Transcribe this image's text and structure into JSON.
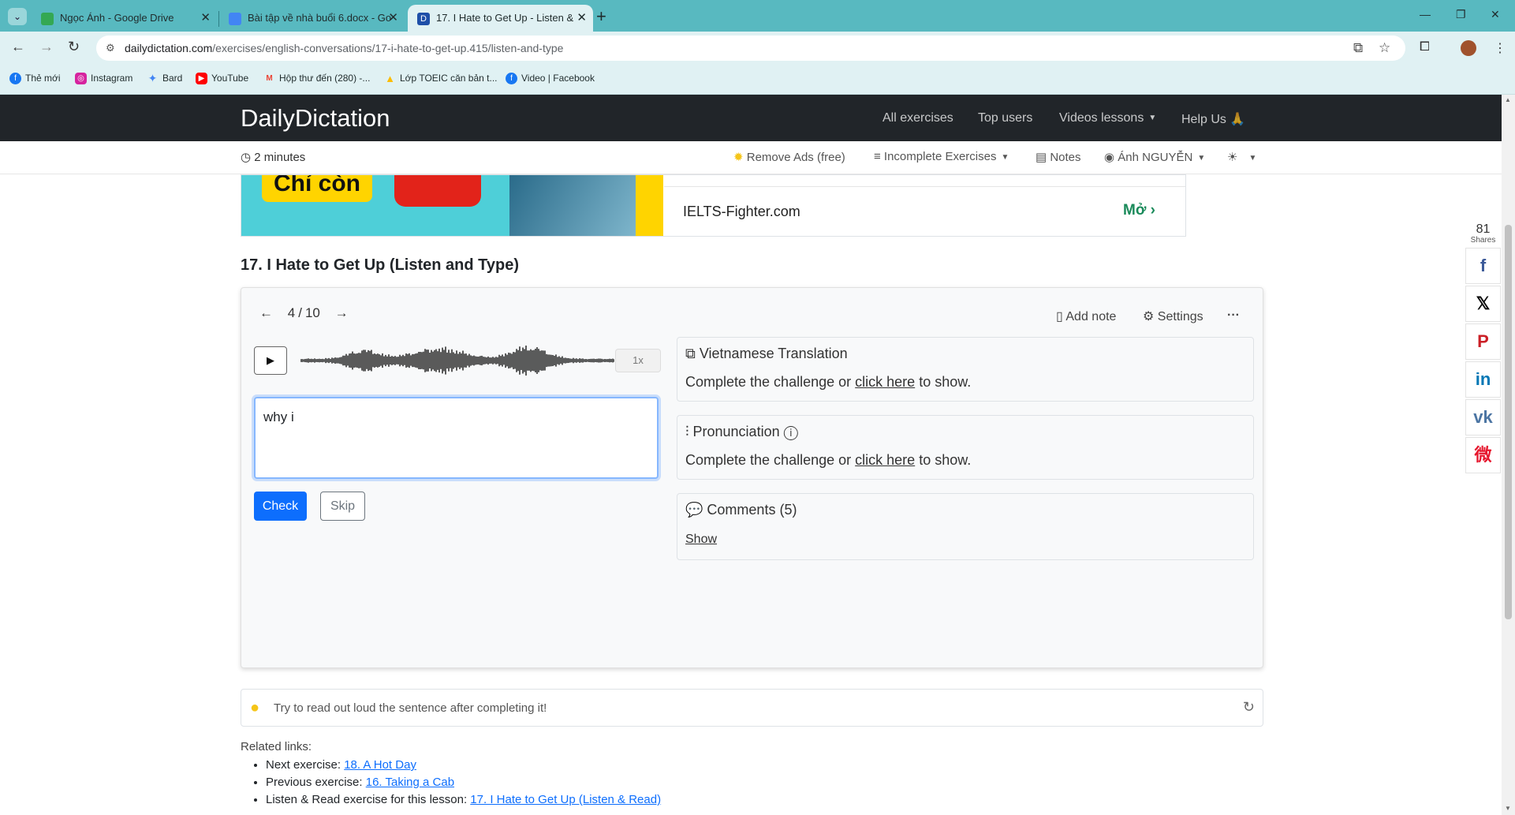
{
  "browser": {
    "tabs": [
      {
        "title": "Ngọc Ánh - Google Drive",
        "color": "#34a853"
      },
      {
        "title": "Bài tập về nhà buổi 6.docx - Go",
        "color": "#4285f4"
      },
      {
        "title": "17. I Hate to Get Up - Listen &",
        "color": "#1e4fa8"
      }
    ],
    "new_tab": "+",
    "url_domain": "dailydictation.com",
    "url_path": "/exercises/english-conversations/17-i-hate-to-get-up.415/listen-and-type",
    "bookmarks": [
      {
        "label": "Thẻ mới",
        "color": "#1877f2"
      },
      {
        "label": "Instagram",
        "color": "#d6249f"
      },
      {
        "label": "Bard",
        "color": "#4285f4"
      },
      {
        "label": "YouTube",
        "color": "#ff0000"
      },
      {
        "label": "Hộp thư đến (280) -...",
        "color": "#ea4335"
      },
      {
        "label": "Lớp TOEIC căn bản t...",
        "color": "#fbbc04"
      },
      {
        "label": "Video | Facebook",
        "color": "#1877f2"
      }
    ]
  },
  "site": {
    "brand": "DailyDictation",
    "nav": {
      "all_exercises": "All exercises",
      "top_users": "Top users",
      "video_lessons": "Videos lessons",
      "help_us": "Help Us 🙏"
    },
    "subbar": {
      "timer": "2 minutes",
      "remove_ads": "Remove Ads (free)",
      "incomplete": "Incomplete Exercises",
      "notes": "Notes",
      "user": "Ánh NGUYỄN"
    }
  },
  "ad": {
    "headline": "Chỉ còn",
    "site": "IELTS-Fighter.com",
    "open": "Mở"
  },
  "exercise": {
    "title": "17. I Hate to Get Up (Listen and Type)",
    "current": "4",
    "total": "10",
    "pager_sep": "/",
    "add_note": "Add note",
    "settings": "Settings",
    "speed": "1x",
    "answer_text": "why i",
    "check_label": "Check",
    "skip_label": "Skip",
    "translation": {
      "title": "Vietnamese Translation",
      "prefix": "Complete the challenge or",
      "link": "click here",
      "suffix": "to show."
    },
    "pronunciation": {
      "title": "Pronunciation",
      "prefix": "Complete the challenge or",
      "link": "click here",
      "suffix": "to show."
    },
    "comments": {
      "title": "Comments (5)",
      "show": "Show"
    }
  },
  "tip": "Try to read out loud the sentence after completing it!",
  "related": {
    "heading": "Related links:",
    "items": [
      {
        "label": "Next exercise:",
        "link": "18. A Hot Day"
      },
      {
        "label": "Previous exercise:",
        "link": "16. Taking a Cab"
      },
      {
        "label": "Listen & Read exercise for this lesson:",
        "link": "17. I Hate to Get Up (Listen & Read)"
      }
    ]
  },
  "share": {
    "count": "81",
    "label": "Shares",
    "buttons": [
      {
        "name": "facebook",
        "glyph": "f",
        "color": "#3b5998"
      },
      {
        "name": "x",
        "glyph": "𝕏",
        "color": "#000000"
      },
      {
        "name": "pinterest",
        "glyph": "P",
        "color": "#cb2027"
      },
      {
        "name": "linkedin",
        "glyph": "in",
        "color": "#0077b5"
      },
      {
        "name": "vk",
        "glyph": "vk",
        "color": "#4c75a3"
      },
      {
        "name": "weibo",
        "glyph": "微",
        "color": "#e6162d"
      }
    ]
  }
}
